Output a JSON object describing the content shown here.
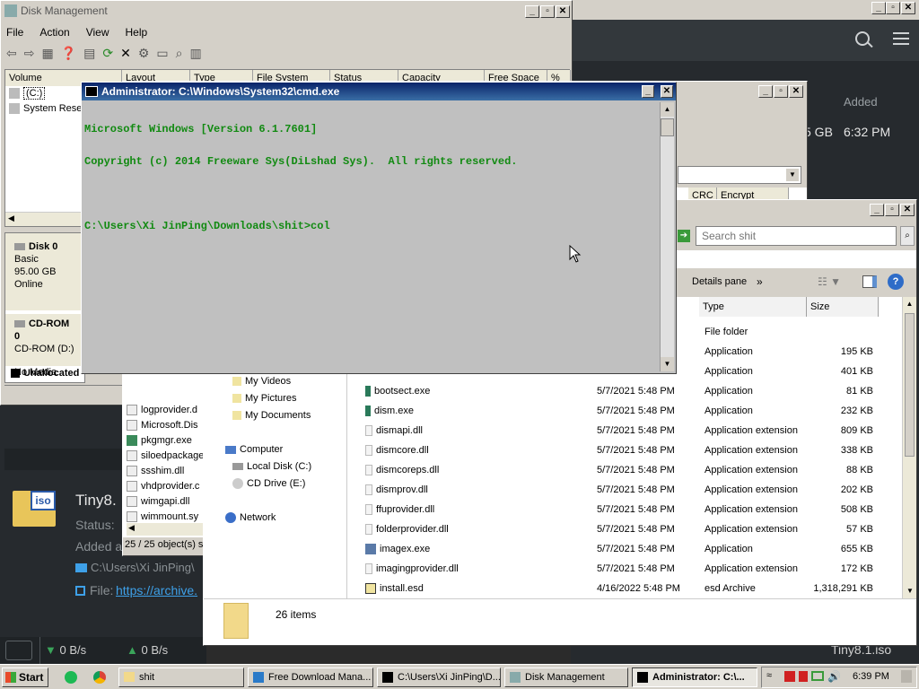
{
  "dark_app": {
    "window_min": "_",
    "window_max": "▫",
    "window_close": "✕",
    "col_added": "Added",
    "row_size": "5 GB",
    "row_time": "6:32 PM",
    "download_title": "Tiny8.",
    "download_status": "Status:",
    "download_added": "Added a",
    "download_path": "C:\\Users\\Xi JinPing\\",
    "download_file_label": "File:",
    "download_file_link": "https://archive.",
    "speed_down": "0 B/s",
    "speed_up": "0 B/s",
    "bottom_name": "Tiny8.1.iso",
    "iso_icon": "iso"
  },
  "disk_mgmt": {
    "title": "Disk Management",
    "menu": [
      "File",
      "Action",
      "View",
      "Help"
    ],
    "columns": [
      "Volume",
      "Layout",
      "Type",
      "File System",
      "Status",
      "Capacity",
      "Free Space",
      "% Fr"
    ],
    "volumes": [
      "(C:)",
      "System Rese"
    ],
    "disk0": {
      "name": "Disk 0",
      "type": "Basic",
      "size": "95.00 GB",
      "state": "Online"
    },
    "cdrom": {
      "name": "CD-ROM 0",
      "drive": "CD-ROM (D:)",
      "media": "No Media"
    },
    "legend": "Unallocated"
  },
  "cmd": {
    "title": "Administrator: C:\\Windows\\System32\\cmd.exe",
    "lines": [
      "Microsoft Windows [Version 6.1.7601]",
      "Copyright (c) 2014 Freeware Sys(DiLshad Sys).  All rights reserved.",
      "",
      "C:\\Users\\Xi JinPing\\Downloads\\shit>col"
    ]
  },
  "archive_win": {
    "columns": [
      "CRC",
      "Encrypt"
    ],
    "files": [
      "logprovider.d",
      "Microsoft.Dis",
      "pkgmgr.exe",
      "siloedpackage",
      "ssshim.dll",
      "vhdprovider.c",
      "wimgapi.dll",
      "wimmount.sy"
    ],
    "status": "25 / 25 object(s) s"
  },
  "explorer": {
    "search_placeholder": "Search shit",
    "details_pane": "Details pane",
    "more": "»",
    "columns": [
      "Type",
      "Size"
    ],
    "nav": [
      "My Videos",
      "My Pictures",
      "My Documents",
      "Computer",
      "Local Disk (C:)",
      "CD Drive (E:)",
      "Network"
    ],
    "top_rows": [
      {
        "type": "File folder",
        "size": ""
      },
      {
        "type": "Application",
        "size": "195 KB"
      },
      {
        "type": "Application",
        "size": "401 KB"
      }
    ],
    "files": [
      {
        "name": "bootsect.exe",
        "date": "5/7/2021 5:48 PM",
        "type": "Application",
        "size": "81 KB"
      },
      {
        "name": "dism.exe",
        "date": "5/7/2021 5:48 PM",
        "type": "Application",
        "size": "232 KB"
      },
      {
        "name": "dismapi.dll",
        "date": "5/7/2021 5:48 PM",
        "type": "Application extension",
        "size": "809 KB"
      },
      {
        "name": "dismcore.dll",
        "date": "5/7/2021 5:48 PM",
        "type": "Application extension",
        "size": "338 KB"
      },
      {
        "name": "dismcoreps.dll",
        "date": "5/7/2021 5:48 PM",
        "type": "Application extension",
        "size": "88 KB"
      },
      {
        "name": "dismprov.dll",
        "date": "5/7/2021 5:48 PM",
        "type": "Application extension",
        "size": "202 KB"
      },
      {
        "name": "ffuprovider.dll",
        "date": "5/7/2021 5:48 PM",
        "type": "Application extension",
        "size": "508 KB"
      },
      {
        "name": "folderprovider.dll",
        "date": "5/7/2021 5:48 PM",
        "type": "Application extension",
        "size": "57 KB"
      },
      {
        "name": "imagex.exe",
        "date": "5/7/2021 5:48 PM",
        "type": "Application",
        "size": "655 KB"
      },
      {
        "name": "imagingprovider.dll",
        "date": "5/7/2021 5:48 PM",
        "type": "Application extension",
        "size": "172 KB"
      },
      {
        "name": "install.esd",
        "date": "4/16/2022 5:48 PM",
        "type": "esd Archive",
        "size": "1,318,291 KB"
      }
    ],
    "items_count": "26 items"
  },
  "taskbar": {
    "start": "Start",
    "buttons": [
      "shit",
      "Free Download Mana...",
      "C:\\Users\\Xi JinPing\\D...",
      "Disk Management",
      "Administrator: C:\\..."
    ],
    "clock": "6:39 PM"
  }
}
